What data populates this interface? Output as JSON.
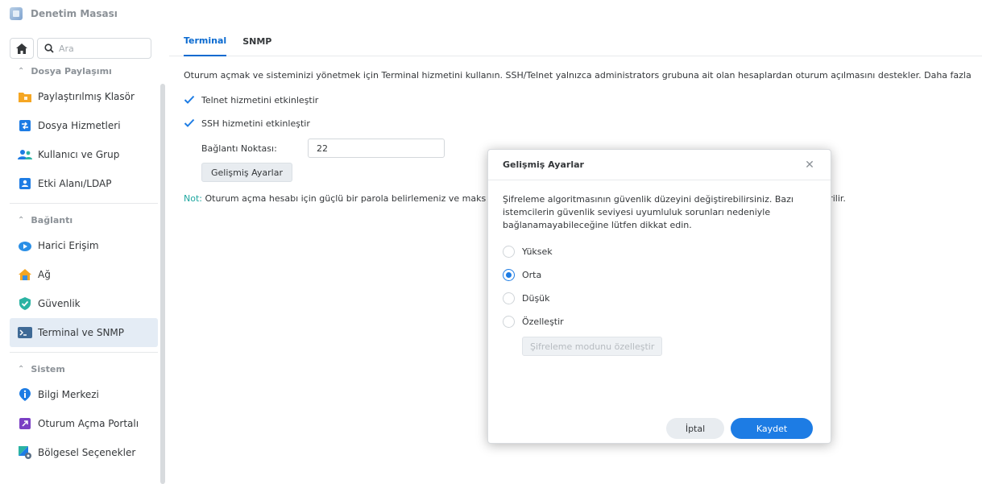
{
  "app": {
    "title": "Denetim Masası"
  },
  "search": {
    "placeholder": "Ara"
  },
  "sidebar": {
    "sections": [
      {
        "label": "Dosya Paylaşımı",
        "items": [
          {
            "label": "Paylaştırılmış Klasör",
            "icon": "shared-folder-icon"
          },
          {
            "label": "Dosya Hizmetleri",
            "icon": "file-services-icon"
          },
          {
            "label": "Kullanıcı ve Grup",
            "icon": "user-group-icon"
          },
          {
            "label": "Etki Alanı/LDAP",
            "icon": "domain-ldap-icon"
          }
        ]
      },
      {
        "label": "Bağlantı",
        "items": [
          {
            "label": "Harici Erişim",
            "icon": "external-access-icon"
          },
          {
            "label": "Ağ",
            "icon": "network-icon"
          },
          {
            "label": "Güvenlik",
            "icon": "security-shield-icon"
          },
          {
            "label": "Terminal ve SNMP",
            "icon": "terminal-icon",
            "active": true
          }
        ]
      },
      {
        "label": "Sistem",
        "items": [
          {
            "label": "Bilgi Merkezi",
            "icon": "info-center-icon"
          },
          {
            "label": "Oturum Açma Portalı",
            "icon": "login-portal-icon"
          },
          {
            "label": "Bölgesel Seçenekler",
            "icon": "regional-options-icon"
          }
        ]
      }
    ]
  },
  "tabs": [
    {
      "label": "Terminal",
      "active": true
    },
    {
      "label": "SNMP",
      "active": false
    }
  ],
  "terminal": {
    "description": "Oturum açmak ve sisteminizi yönetmek için Terminal hizmetini kullanın. SSH/Telnet yalnızca administrators grubuna ait olan hesaplardan oturum açılmasını destekler. Daha fazla",
    "telnet_label": "Telnet hizmetini etkinleştir",
    "telnet_checked": true,
    "ssh_label": "SSH hizmetini etkinleştir",
    "ssh_checked": true,
    "port_label": "Bağlantı Noktası:",
    "port_value": "22",
    "advanced_button": "Gelişmiş Ayarlar",
    "note_label": "Not:",
    "note_text": " Oturum açma hesabı için güçlü bir parola belirlemeniz ve maks",
    "note_tail": "rilir."
  },
  "modal": {
    "title": "Gelişmiş Ayarlar",
    "description": "Şifreleme algoritmasının güvenlik düzeyini değiştirebilirsiniz. Bazı istemcilerin güvenlik seviyesi uyumluluk sorunları nedeniyle bağlanamayabileceğine lütfen dikkat edin.",
    "options": [
      {
        "label": "Yüksek",
        "selected": false
      },
      {
        "label": "Orta",
        "selected": true
      },
      {
        "label": "Düşük",
        "selected": false
      },
      {
        "label": "Özelleştir",
        "selected": false
      }
    ],
    "custom_button": "Şifreleme modunu özelleştir",
    "cancel": "İptal",
    "save": "Kaydet"
  },
  "colors": {
    "accent": "#1d7ce4",
    "tab_active": "#0a6ad0",
    "note": "#1fa7a0"
  }
}
